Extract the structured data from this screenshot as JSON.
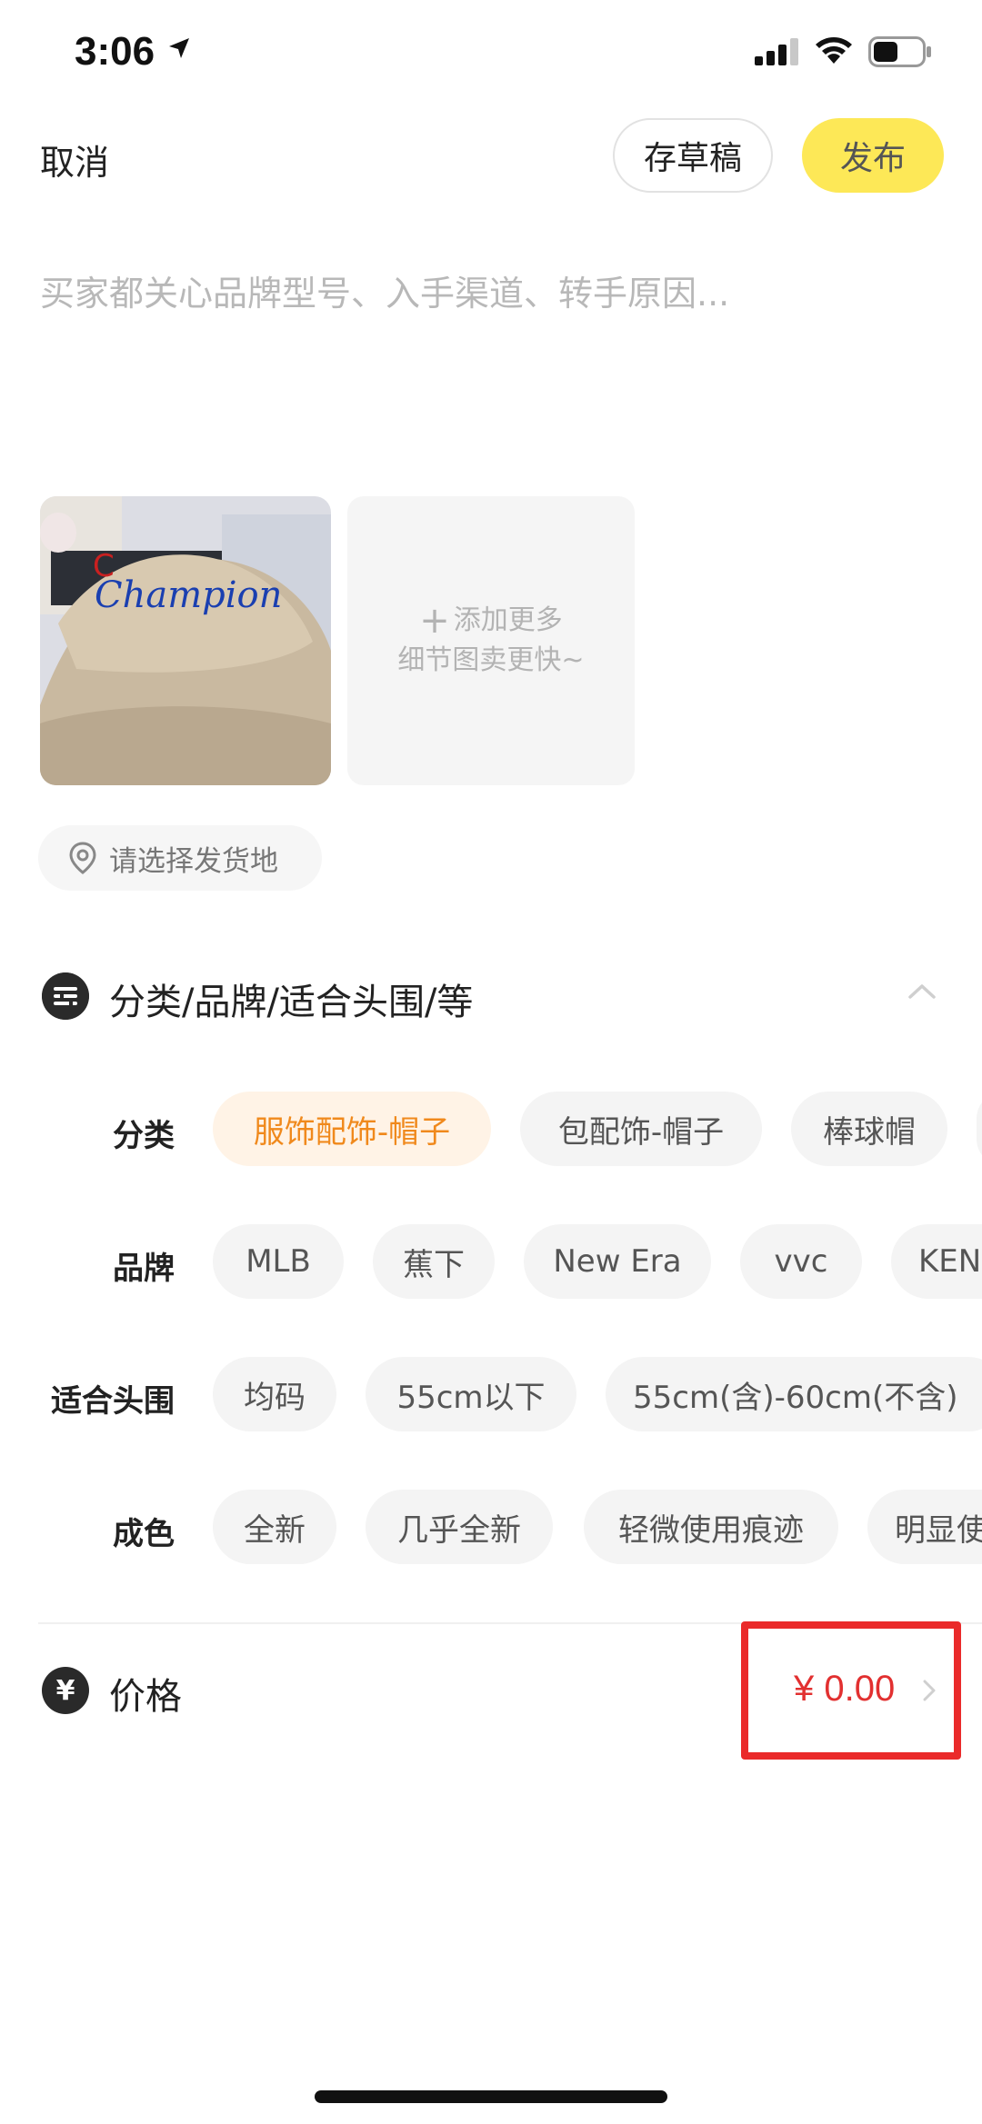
{
  "status_bar": {
    "time": "3:06"
  },
  "header": {
    "cancel_label": "取消",
    "draft_label": "存草稿",
    "publish_label": "发布"
  },
  "description": {
    "placeholder": "买家都关心品牌型号、入手渠道、转手原因..."
  },
  "photos": {
    "add_more_line1": "添加更多",
    "add_more_line2": "细节图卖更快~"
  },
  "location": {
    "label": "请选择发货地"
  },
  "attributes": {
    "title": "分类/品牌/适合头围/等",
    "rows": [
      {
        "label": "分类",
        "options": [
          "服饰配饰-帽子",
          "包配饰-帽子",
          "棒球帽"
        ],
        "selected": 0
      },
      {
        "label": "品牌",
        "options": [
          "MLB",
          "蕉下",
          "New Era",
          "vvc",
          "KENZO"
        ]
      },
      {
        "label": "适合头围",
        "options": [
          "均码",
          "55cm以下",
          "55cm(含)-60cm(不含)"
        ]
      },
      {
        "label": "成色",
        "options": [
          "全新",
          "几乎全新",
          "轻微使用痕迹",
          "明显使用痕迹"
        ]
      }
    ]
  },
  "price": {
    "icon_text": "¥",
    "label": "价格",
    "value": "¥ 0.00"
  },
  "colors": {
    "publish_bg": "#fde857",
    "selected_chip_text": "#f0891c",
    "price_text": "#e23030",
    "highlight_border": "#ea2a2a"
  }
}
